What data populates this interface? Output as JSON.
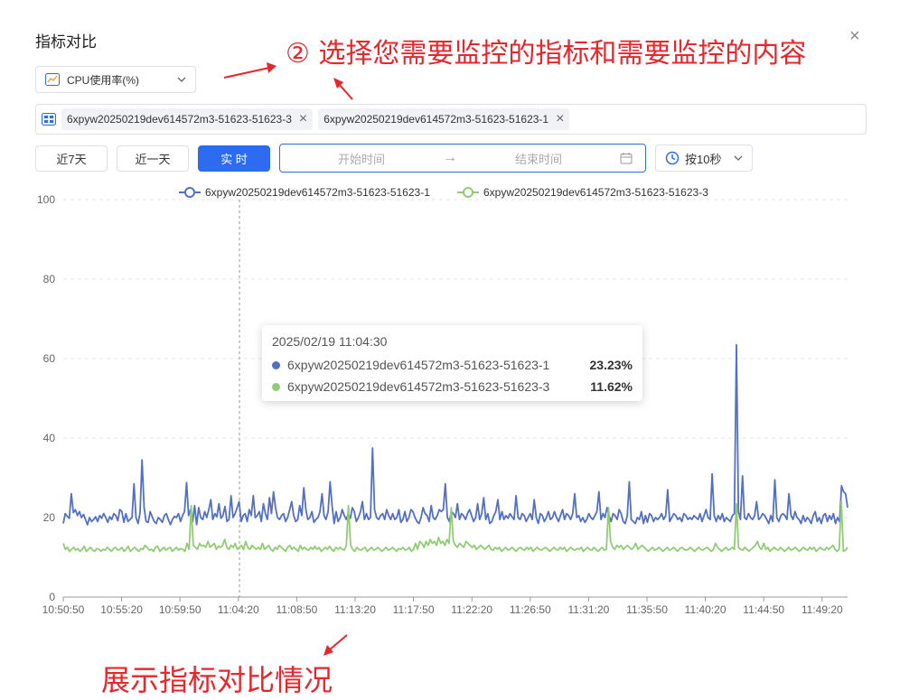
{
  "dialog": {
    "title": "指标对比",
    "close_glyph": "×"
  },
  "annotations": {
    "top": "② 选择您需要监控的指标和需要监控的内容",
    "bottom": "展示指标对比情况"
  },
  "metric_select": {
    "icon": "line-chart-icon",
    "value": "CPU使用率(%)"
  },
  "instances": [
    {
      "label": "6xpyw20250219dev614572m3-51623-51623-3"
    },
    {
      "label": "6xpyw20250219dev614572m3-51623-51623-1"
    }
  ],
  "range_buttons": {
    "seven_days": "近7天",
    "one_day": "近一天",
    "realtime": "实 时"
  },
  "date_range": {
    "start_placeholder": "开始时间",
    "separator": "→",
    "end_placeholder": "结束时间"
  },
  "interval": {
    "label": "按10秒"
  },
  "colors": {
    "primary": "#2d6cf0",
    "series1": "#5470c6",
    "series3": "#91cc75",
    "annotation": "#e8262b"
  },
  "tooltip": {
    "time": "2025/02/19 11:04:30",
    "rows": [
      {
        "name": "6xpyw20250219dev614572m3-51623-51623-1",
        "value": "23.23%"
      },
      {
        "name": "6xpyw20250219dev614572m3-51623-51623-3",
        "value": "11.62%"
      }
    ]
  },
  "chart_data": {
    "type": "line",
    "legend_position": "top-center",
    "ylim": [
      0,
      100
    ],
    "yticks": [
      0,
      20,
      40,
      60,
      80,
      100
    ],
    "xlabels": [
      "10:50:50",
      "10:55:20",
      "10:59:50",
      "11:04:20",
      "11:08:50",
      "11:13:20",
      "11:17:50",
      "11:22:20",
      "11:26:50",
      "11:31:20",
      "11:35:50",
      "11:40:20",
      "11:44:50",
      "11:49:20"
    ],
    "crosshair_time": "11:04:30",
    "series": [
      {
        "name": "6xpyw20250219dev614572m3-51623-51623-1",
        "color": "#5470c6",
        "values": [
          18.5,
          21.0,
          20.3,
          19.8,
          26.0,
          21.2,
          22.0,
          20.5,
          21.5,
          20.0,
          20.8,
          19.5,
          18.2,
          20.0,
          19.0,
          19.5,
          20.2,
          19.0,
          20.5,
          19.8,
          21.0,
          20.0,
          18.8,
          20.2,
          19.5,
          21.0,
          20.5,
          19.2,
          22.0,
          21.5,
          18.8,
          21.0,
          19.0,
          19.5,
          20.0,
          28.5,
          20.0,
          18.5,
          21.2,
          34.5,
          22.5,
          19.0,
          18.8,
          21.5,
          20.2,
          19.0,
          18.5,
          20.0,
          19.5,
          18.8,
          20.5,
          21.0,
          19.5,
          18.2,
          19.5,
          20.3,
          20.0,
          21.0,
          19.0,
          20.5,
          21.5,
          28.8,
          20.5,
          22.0,
          19.0,
          23.0,
          18.2,
          22.5,
          20.0,
          19.5,
          21.5,
          20.0,
          22.0,
          24.5,
          19.5,
          21.0,
          20.2,
          23.5,
          19.8,
          20.5,
          22.8,
          19.0,
          19.5,
          25.5,
          20.0,
          21.0,
          22.5,
          24.0,
          19.0,
          20.5,
          21.0,
          19.0,
          22.0,
          20.5,
          25.5,
          20.0,
          20.5,
          21.5,
          19.0,
          23.5,
          21.0,
          19.5,
          25.0,
          21.0,
          26.5,
          22.5,
          20.0,
          19.5,
          20.5,
          21.0,
          19.0,
          20.0,
          22.0,
          24.0,
          20.5,
          19.0,
          19.5,
          23.0,
          20.5,
          27.5,
          22.0,
          19.5,
          20.0,
          21.5,
          18.8,
          19.5,
          20.0,
          21.5,
          26.0,
          20.5,
          19.5,
          21.5,
          29.0,
          23.0,
          18.5,
          21.5,
          19.0,
          20.0,
          22.0,
          20.5,
          19.5,
          21.0,
          19.8,
          22.5,
          21.5,
          19.0,
          20.0,
          21.5,
          24.0,
          19.5,
          21.0,
          19.5,
          20.0,
          37.5,
          22.0,
          20.0,
          19.5,
          20.5,
          21.0,
          19.5,
          22.0,
          20.5,
          19.5,
          21.0,
          19.5,
          20.0,
          22.0,
          18.8,
          19.5,
          21.5,
          19.0,
          20.0,
          22.0,
          21.5,
          20.0,
          19.0,
          18.5,
          20.0,
          22.5,
          21.0,
          20.5,
          19.0,
          23.0,
          20.0,
          19.5,
          20.5,
          22.0,
          21.5,
          22.0,
          28.5,
          20.0,
          19.0,
          21.5,
          21.0,
          20.0,
          23.5,
          19.5,
          21.0,
          20.5,
          19.5,
          21.0,
          22.0,
          20.5,
          19.0,
          20.0,
          23.5,
          19.5,
          21.0,
          25.0,
          19.5,
          21.0,
          18.5,
          19.0,
          20.5,
          21.5,
          24.5,
          19.5,
          21.5,
          19.5,
          20.5,
          19.8,
          21.0,
          20.2,
          19.5,
          25.5,
          20.0,
          19.5,
          21.0,
          20.5,
          19.0,
          20.0,
          21.0,
          19.5,
          24.5,
          20.0,
          18.5,
          21.0,
          20.5,
          19.0,
          20.0,
          21.5,
          19.5,
          20.0,
          21.5,
          20.0,
          19.0,
          20.5,
          22.0,
          19.5,
          21.0,
          20.5,
          19.5,
          21.0,
          26.0,
          20.0,
          20.5,
          19.0,
          20.0,
          18.8,
          19.5,
          21.0,
          20.0,
          19.5,
          20.5,
          21.5,
          26.5,
          19.5,
          21.0,
          20.0,
          22.5,
          20.5,
          19.0,
          21.0,
          20.5,
          19.5,
          22.0,
          21.0,
          19.0,
          18.5,
          20.5,
          29.0,
          19.5,
          19.0,
          18.5,
          20.0,
          19.5,
          21.5,
          18.5,
          20.5,
          18.8,
          21.0,
          20.5,
          19.0,
          20.0,
          19.5,
          20.0,
          21.0,
          19.5,
          20.5,
          27.0,
          19.0,
          20.0,
          21.0,
          20.5,
          19.5,
          20.0,
          19.0,
          21.0,
          20.5,
          19.5,
          20.0,
          19.5,
          20.5,
          20.0,
          19.5,
          21.0,
          19.0,
          20.5,
          22.0,
          20.0,
          19.5,
          31.0,
          20.5,
          19.0,
          20.5,
          19.5,
          21.0,
          19.0,
          20.0,
          19.5,
          19.0,
          20.5,
          21.0,
          63.5,
          21.5,
          19.5,
          30.5,
          20.0,
          19.5,
          21.0,
          20.0,
          19.5,
          20.5,
          24.0,
          19.5,
          20.0,
          21.0,
          20.5,
          19.5,
          18.5,
          20.5,
          19.0,
          29.5,
          20.0,
          19.0,
          20.5,
          21.0,
          20.5,
          19.5,
          26.0,
          20.5,
          19.5,
          21.5,
          20.0,
          19.5,
          18.5,
          20.5,
          19.0,
          20.0,
          19.5,
          18.5,
          20.5,
          21.5,
          19.0,
          20.0,
          18.5,
          20.5,
          21.0,
          19.0,
          20.5,
          19.5,
          21.0,
          18.5,
          20.0,
          19.0,
          28.0,
          26.5,
          26.0,
          22.5
        ]
      },
      {
        "name": "6xpyw20250219dev614572m3-51623-51623-3",
        "color": "#91cc75",
        "values": [
          13.5,
          12.0,
          12.5,
          11.5,
          12.0,
          12.5,
          11.8,
          12.2,
          11.5,
          12.0,
          12.8,
          11.5,
          12.0,
          12.5,
          11.8,
          11.5,
          12.2,
          12.0,
          11.5,
          12.0,
          11.8,
          12.5,
          12.0,
          11.5,
          12.2,
          12.5,
          11.8,
          12.0,
          12.5,
          11.5,
          12.0,
          12.8,
          11.5,
          12.0,
          12.5,
          12.0,
          11.5,
          12.2,
          12.0,
          13.0,
          12.5,
          11.8,
          12.0,
          11.5,
          12.5,
          12.8,
          11.5,
          12.0,
          12.5,
          11.8,
          12.2,
          12.5,
          11.5,
          12.0,
          12.5,
          11.8,
          12.2,
          12.0,
          11.5,
          13.5,
          12.0,
          23.0,
          13.0,
          12.5,
          12.0,
          13.5,
          12.8,
          13.0,
          12.5,
          14.0,
          12.5,
          13.0,
          13.5,
          12.0,
          12.8,
          12.5,
          13.0,
          14.5,
          12.5,
          12.0,
          13.0,
          12.5,
          13.5,
          12.0,
          12.5,
          13.0,
          12.0,
          14.0,
          12.5,
          12.0,
          13.0,
          12.5,
          12.0,
          12.5,
          12.0,
          13.5,
          12.0,
          12.5,
          13.0,
          12.0,
          11.5,
          12.5,
          12.0,
          13.0,
          12.5,
          12.0,
          11.5,
          12.5,
          13.0,
          12.0,
          12.5,
          12.0,
          11.5,
          13.0,
          12.0,
          12.5,
          12.0,
          11.8,
          12.5,
          12.0,
          12.8,
          12.0,
          12.5,
          11.5,
          12.0,
          12.5,
          12.0,
          12.8,
          12.0,
          11.5,
          12.5,
          12.0,
          12.5,
          12.0,
          11.8,
          13.0,
          23.0,
          13.0,
          12.0,
          11.5,
          12.5,
          12.0,
          11.8,
          12.2,
          12.5,
          11.5,
          12.0,
          12.5,
          11.8,
          12.0,
          12.5,
          12.0,
          11.5,
          12.0,
          12.5,
          11.8,
          12.0,
          12.5,
          12.0,
          11.5,
          12.2,
          12.0,
          12.5,
          11.8,
          12.0,
          12.5,
          11.5,
          12.0,
          13.5,
          12.0,
          14.0,
          13.5,
          12.5,
          14.0,
          13.0,
          14.5,
          13.5,
          14.0,
          13.0,
          15.0,
          13.5,
          14.0,
          13.0,
          14.5,
          13.5,
          22.5,
          14.0,
          13.0,
          12.5,
          13.5,
          13.0,
          12.5,
          14.0,
          13.5,
          13.0,
          12.5,
          13.0,
          12.0,
          12.5,
          13.0,
          12.5,
          12.0,
          12.5,
          13.0,
          12.0,
          11.8,
          12.5,
          12.0,
          12.5,
          11.5,
          12.0,
          12.5,
          11.8,
          12.0,
          12.5,
          12.0,
          11.5,
          12.2,
          12.5,
          12.0,
          11.8,
          12.5,
          12.0,
          12.5,
          11.5,
          12.0,
          12.5,
          12.0,
          11.8,
          12.2,
          12.5,
          12.0,
          11.5,
          12.0,
          12.5,
          12.0,
          11.8,
          12.5,
          12.0,
          12.5,
          11.5,
          12.0,
          12.5,
          12.0,
          11.8,
          12.2,
          12.0,
          12.5,
          11.5,
          12.0,
          12.5,
          12.0,
          11.8,
          12.5,
          12.0,
          11.5,
          12.0,
          12.5,
          11.8,
          12.0,
          22.5,
          14.0,
          12.5,
          12.0,
          13.0,
          12.5,
          13.0,
          12.0,
          12.5,
          13.0,
          12.5,
          12.0,
          12.5,
          13.5,
          12.0,
          12.5,
          13.0,
          12.5,
          12.0,
          11.5,
          12.0,
          12.5,
          11.8,
          12.0,
          12.5,
          12.0,
          11.5,
          12.0,
          12.5,
          11.8,
          12.0,
          12.5,
          12.0,
          11.5,
          12.2,
          12.5,
          12.0,
          11.8,
          12.0,
          12.5,
          12.0,
          11.5,
          12.0,
          12.5,
          12.0,
          11.8,
          12.2,
          12.5,
          12.0,
          11.5,
          12.0,
          13.5,
          12.5,
          12.0,
          11.5,
          12.0,
          12.5,
          11.8,
          12.0,
          12.5,
          12.0,
          23.5,
          12.5,
          12.0,
          11.8,
          12.5,
          12.0,
          11.5,
          12.0,
          12.5,
          13.0,
          14.0,
          12.5,
          12.0,
          13.5,
          12.0,
          12.5,
          11.5,
          12.0,
          12.5,
          12.0,
          11.8,
          12.5,
          12.0,
          11.5,
          12.0,
          12.5,
          11.8,
          12.0,
          12.5,
          12.0,
          11.5,
          12.0,
          12.5,
          12.0,
          11.8,
          12.5,
          12.0,
          12.5,
          11.5,
          12.0,
          12.5,
          12.0,
          11.8,
          12.5,
          12.0,
          12.5,
          13.0,
          12.0,
          11.5,
          12.0,
          24.0,
          11.5,
          11.8,
          12.5
        ]
      }
    ]
  }
}
